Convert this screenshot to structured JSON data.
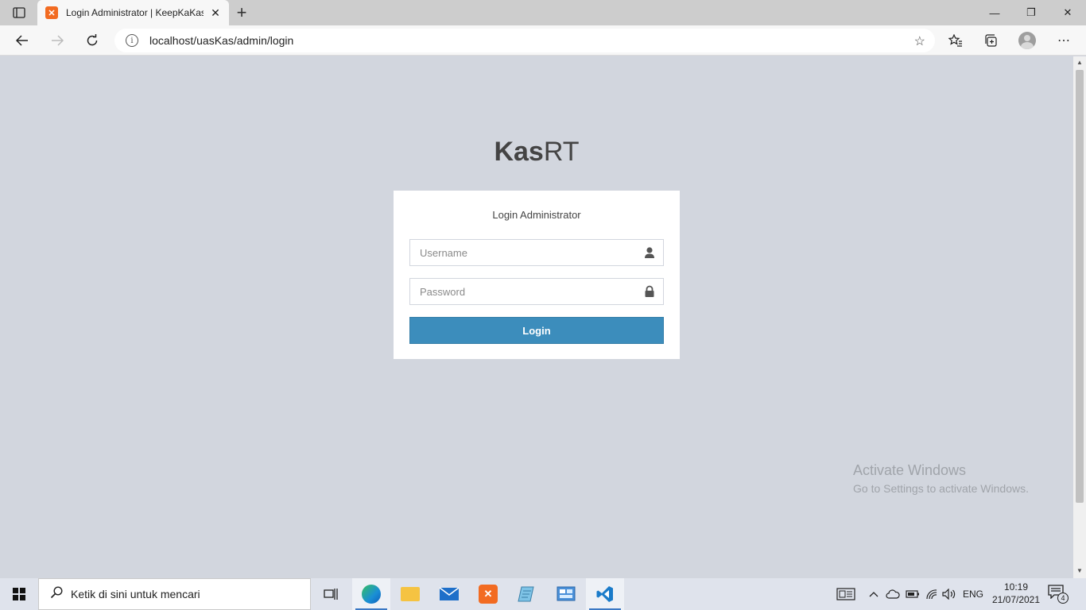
{
  "browser": {
    "tab_title": "Login Administrator | KeepKaKas",
    "tab_close": "✕",
    "new_tab": "+",
    "url": "localhost/uasKas/admin/login",
    "window_controls": {
      "minimize": "—",
      "maximize": "❐",
      "close": "✕"
    },
    "icons": [
      "tab-actions-icon",
      "back-icon",
      "forward-icon",
      "refresh-icon",
      "info-icon",
      "add-favorite-icon",
      "favorites-icon",
      "collections-icon",
      "profile-avatar",
      "more-icon"
    ]
  },
  "page": {
    "logo_bold": "Kas",
    "logo_light": "RT",
    "box_message": "Login Administrator",
    "username_placeholder": "Username",
    "password_placeholder": "Password",
    "login_button": "Login"
  },
  "watermark": {
    "line1": "Activate Windows",
    "line2": "Go to Settings to activate Windows."
  },
  "taskbar": {
    "search_placeholder": "Ketik di sini untuk mencari",
    "language": "ENG",
    "time": "10:19",
    "date": "21/07/2021",
    "notification_count": "4",
    "apps": [
      "task-view",
      "edge",
      "file-explorer",
      "mail",
      "xampp",
      "notepad",
      "control-panel",
      "vscode"
    ]
  }
}
